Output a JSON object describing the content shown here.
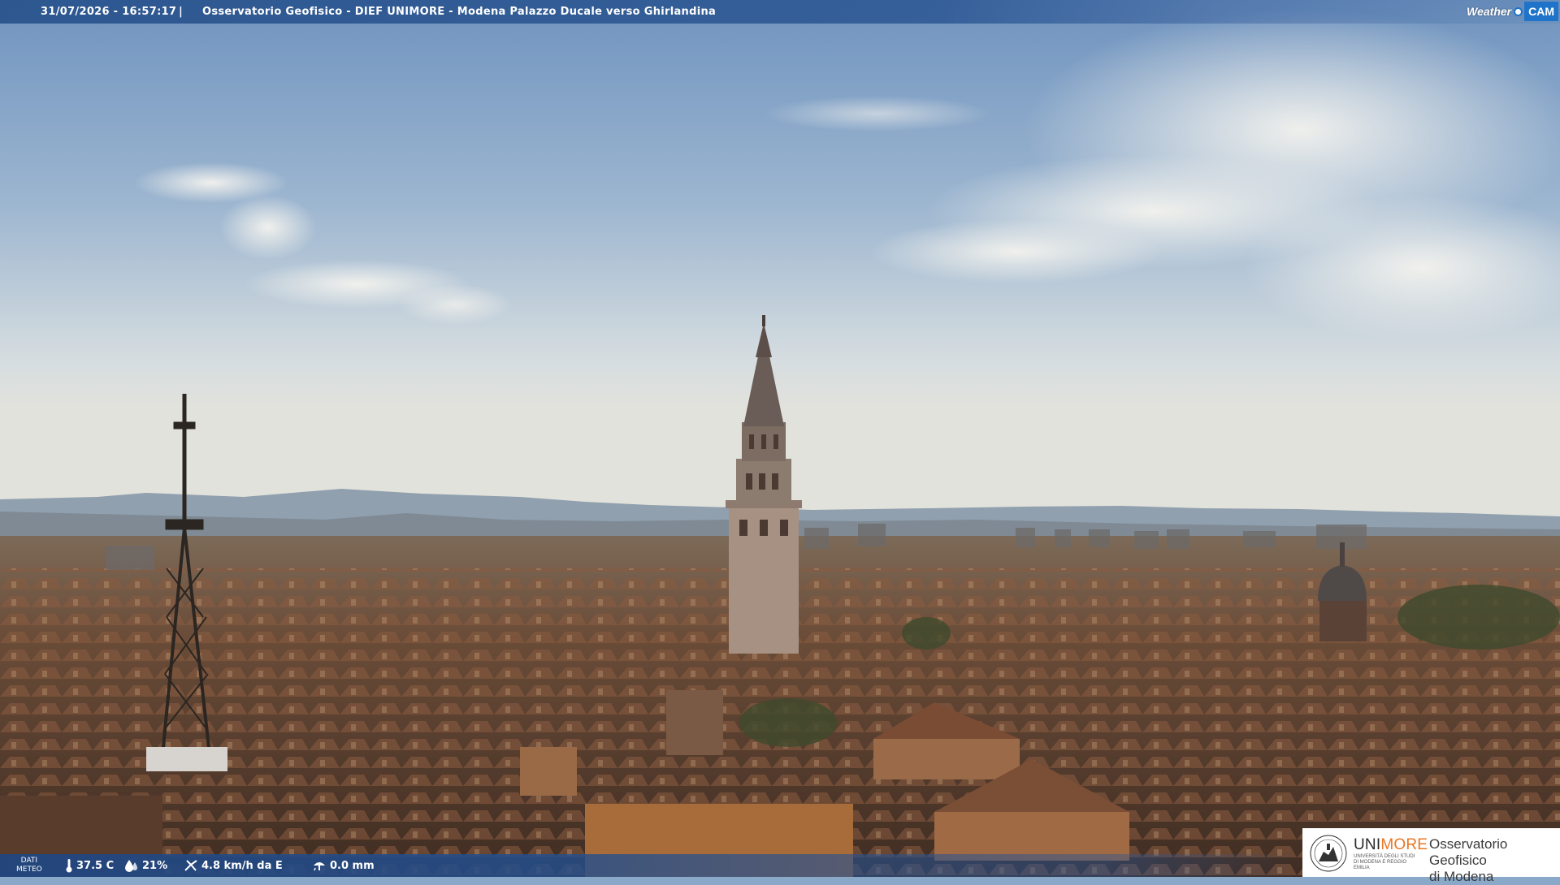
{
  "header": {
    "timestamp": "31/07/2026 - 16:57:17",
    "separator": "|",
    "title": "Osservatorio Geofisico - DIEF UNIMORE - Modena Palazzo Ducale verso Ghirlandina",
    "logo_weather": "Weather",
    "logo_cam": "CAM"
  },
  "weather": {
    "label_line1": "DATI",
    "label_line2": "METEO",
    "temperature": "37.5 C",
    "humidity": "21%",
    "wind": "4.8 km/h da E",
    "rain": "0.0 mm",
    "icons": [
      "thermometer-icon",
      "humidity-drop-icon",
      "wind-icon",
      "rain-gauge-icon"
    ]
  },
  "institution": {
    "name_a": "UNI",
    "name_b": "MORE",
    "subtitle": "UNIVERSITÀ DEGLI STUDI DI MODENA E REGGIO EMILIA",
    "observatory_line1": "Osservatorio Geofisico",
    "observatory_line2": "di Modena"
  },
  "colors": {
    "header_bar": "#2d5894",
    "accent_orange": "#e87722",
    "cam_blue": "#1f74c9"
  }
}
